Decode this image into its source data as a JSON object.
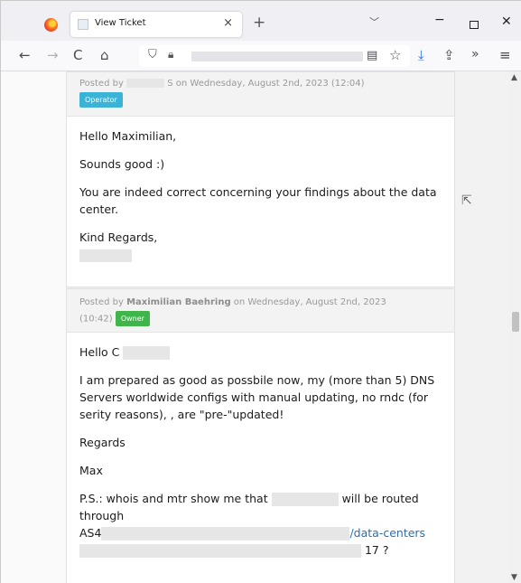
{
  "browser": {
    "tab_title": "View Ticket",
    "tab_close": "×",
    "new_tab": "+",
    "tab_list": "﹀",
    "min": "−",
    "close": "✕",
    "nav": {
      "back": "←",
      "forward": "→",
      "reload": "C",
      "home": "⌂",
      "more": "»",
      "menu": "≡"
    }
  },
  "posts": [
    {
      "header_prefix": "Posted by",
      "author_tail": "S",
      "date_text": "on Wednesday, August 2nd, 2023 (12:04)",
      "badge": "Operator",
      "body": [
        "Hello Maximilian,",
        "Sounds good :)",
        "You are indeed correct concerning your findings about the data center.",
        "Kind Regards,"
      ]
    },
    {
      "header_prefix": "Posted by",
      "author": "Maximilian Baehring",
      "date_text": "on Wednesday, August 2nd, 2023",
      "time": "(10:42)",
      "badge": "Owner",
      "greeting": "Hello C",
      "body": [
        "I am prepared as good as possbile now, my (more than 5) DNS Servers worldwide configs with manual updating, no rndc (for serity reasons), , are \"pre-\"updated!",
        "Regards",
        "Max"
      ],
      "ps_start": "P.S.: whois and mtr show me that",
      "ps_end": "will be routed through",
      "as_prefix": "AS4",
      "as_suffix": "/data-centers",
      "last_tail": "17 ?"
    }
  ]
}
